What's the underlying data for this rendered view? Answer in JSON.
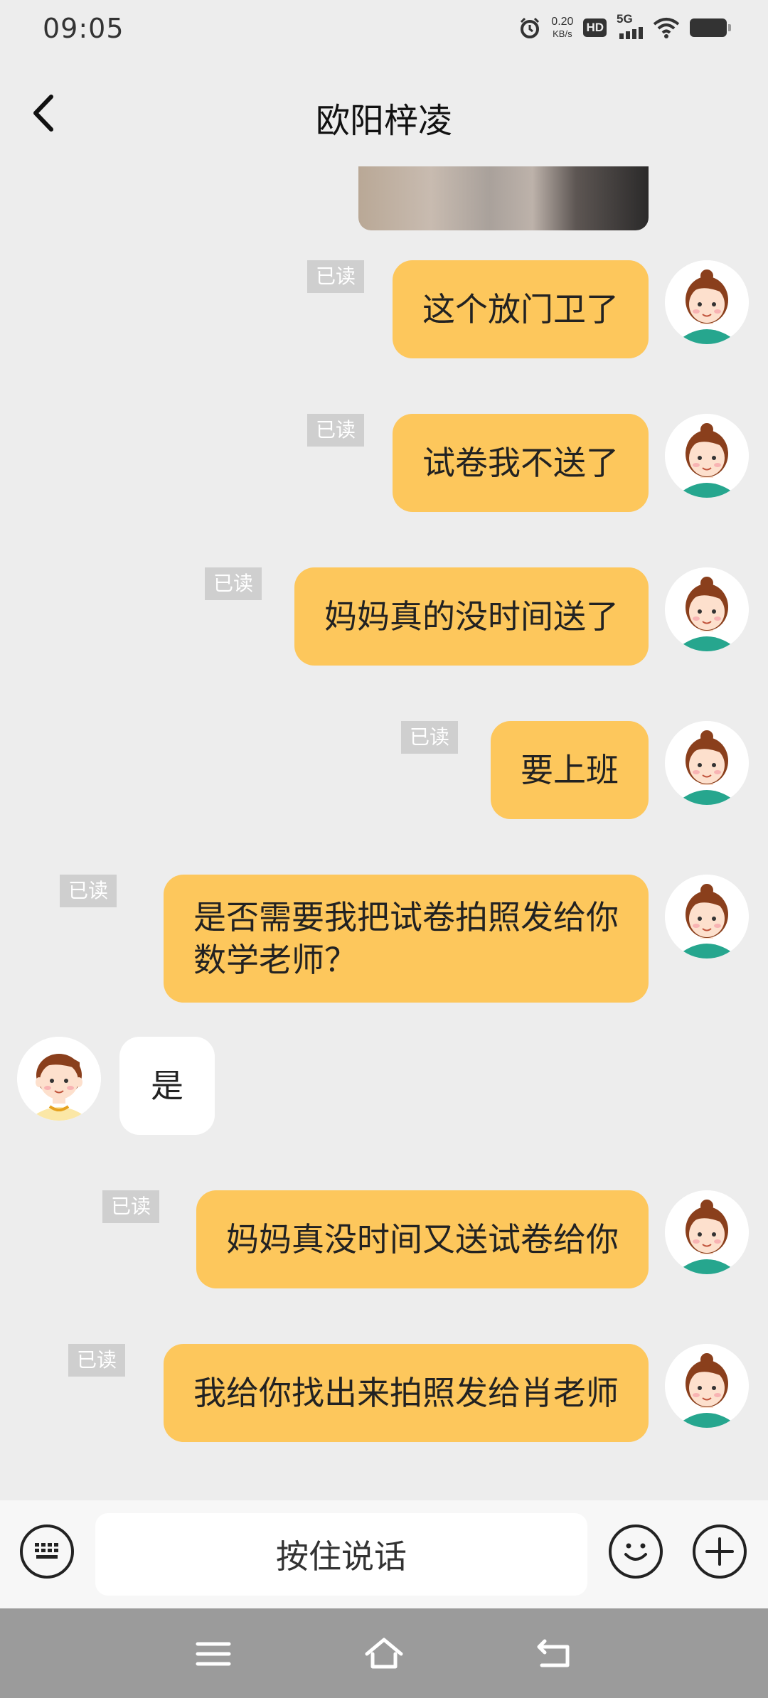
{
  "status_bar": {
    "time": "09:05",
    "net_speed_value": "0.20",
    "net_speed_unit": "KB/s",
    "hd": "HD",
    "network": "5G"
  },
  "header": {
    "title": "欧阳梓凌"
  },
  "messages": [
    {
      "from": "me",
      "text": "这个放门卫了",
      "read": "已读"
    },
    {
      "from": "me",
      "text": "试卷我不送了",
      "read": "已读"
    },
    {
      "from": "me",
      "text": "妈妈真的没时间送了",
      "read": "已读"
    },
    {
      "from": "me",
      "text": "要上班",
      "read": "已读"
    },
    {
      "from": "me",
      "text_line1": "是否需要我把试卷拍照发给你",
      "text_line2": "数学老师？",
      "read": "已读"
    },
    {
      "from": "other",
      "text": "是"
    },
    {
      "from": "me",
      "text": "妈妈真没时间又送试卷给你",
      "read": "已读"
    },
    {
      "from": "me",
      "text": "我给你找出来拍照发给肖老师",
      "read": "已读"
    }
  ],
  "input_bar": {
    "voice_label": "按住说话"
  },
  "colors": {
    "sent_bubble": "#fdc75c",
    "background": "#ededed",
    "read_tag": "#cfcfcf"
  }
}
